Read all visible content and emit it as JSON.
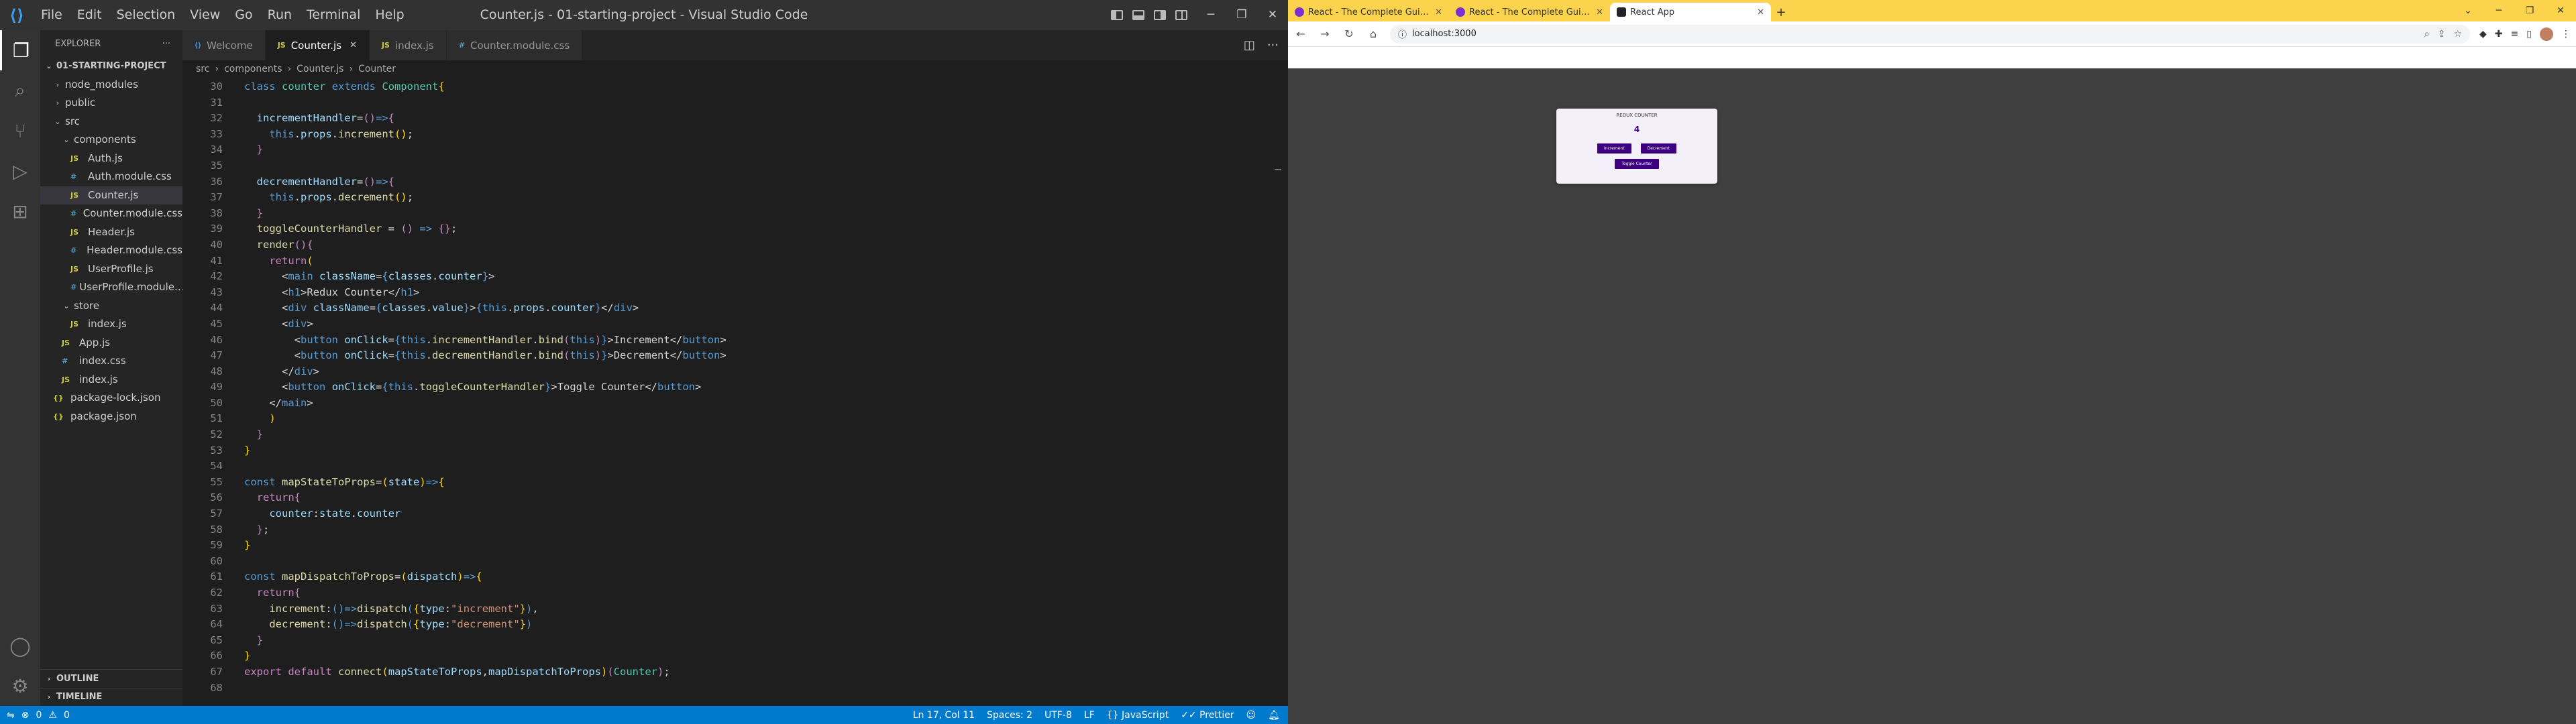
{
  "vscode": {
    "window_title": "Counter.js - 01-starting-project - Visual Studio Code",
    "menu": [
      "File",
      "Edit",
      "Selection",
      "View",
      "Go",
      "Run",
      "Terminal",
      "Help"
    ],
    "explorer_title": "EXPLORER",
    "project": "01-STARTING-PROJECT",
    "tree": [
      {
        "label": "node_modules",
        "type": "folder",
        "depth": 1,
        "open": false
      },
      {
        "label": "public",
        "type": "folder",
        "depth": 1,
        "open": false
      },
      {
        "label": "src",
        "type": "folder",
        "depth": 1,
        "open": true
      },
      {
        "label": "components",
        "type": "folder",
        "depth": 2,
        "open": true
      },
      {
        "label": "Auth.js",
        "type": "js",
        "depth": 3
      },
      {
        "label": "Auth.module.css",
        "type": "css",
        "depth": 3
      },
      {
        "label": "Counter.js",
        "type": "js",
        "depth": 3,
        "selected": true
      },
      {
        "label": "Counter.module.css",
        "type": "css",
        "depth": 3
      },
      {
        "label": "Header.js",
        "type": "js",
        "depth": 3
      },
      {
        "label": "Header.module.css",
        "type": "css",
        "depth": 3
      },
      {
        "label": "UserProfile.js",
        "type": "js",
        "depth": 3
      },
      {
        "label": "UserProfile.module...",
        "type": "css",
        "depth": 3
      },
      {
        "label": "store",
        "type": "folder",
        "depth": 2,
        "open": true
      },
      {
        "label": "index.js",
        "type": "js",
        "depth": 3
      },
      {
        "label": "App.js",
        "type": "js",
        "depth": 2
      },
      {
        "label": "index.css",
        "type": "css",
        "depth": 2
      },
      {
        "label": "index.js",
        "type": "js",
        "depth": 2
      },
      {
        "label": "package-lock.json",
        "type": "json",
        "depth": 1
      },
      {
        "label": "package.json",
        "type": "json",
        "depth": 1
      }
    ],
    "outline": "OUTLINE",
    "timeline": "TIMELINE",
    "tabs": [
      {
        "label": "Welcome",
        "icon": "vscode-icon",
        "active": false
      },
      {
        "label": "Counter.js",
        "icon": "JS",
        "active": true
      },
      {
        "label": "index.js",
        "icon": "JS",
        "active": false
      },
      {
        "label": "Counter.module.css",
        "icon": "#",
        "active": false
      }
    ],
    "breadcrumb": [
      "src",
      "components",
      "Counter.js",
      "Counter"
    ],
    "code_lines": [
      {
        "n": "30",
        "html": "<span class='k'>class</span> <span class='c'>counter</span> <span class='k'>extends</span> <span class='c'>Component</span><span class='y'>{</span>"
      },
      {
        "n": "31",
        "html": ""
      },
      {
        "n": "32",
        "html": "  <span class='v'>incrementHandler</span><span class='p'>=</span><span class='kw'>()</span><span class='k'>=></span><span class='kw'>{</span>"
      },
      {
        "n": "33",
        "html": "    <span class='k'>this</span><span class='p'>.</span><span class='v'>props</span><span class='p'>.</span><span class='f'>increment</span><span class='y'>()</span><span class='p'>;</span>"
      },
      {
        "n": "34",
        "html": "  <span class='kw'>}</span>"
      },
      {
        "n": "35",
        "html": ""
      },
      {
        "n": "36",
        "html": "  <span class='v'>decrementHandler</span><span class='p'>=</span><span class='kw'>()</span><span class='k'>=></span><span class='kw'>{</span>"
      },
      {
        "n": "37",
        "html": "    <span class='k'>this</span><span class='p'>.</span><span class='v'>props</span><span class='p'>.</span><span class='f'>decrement</span><span class='y'>()</span><span class='p'>;</span>"
      },
      {
        "n": "38",
        "html": "  <span class='kw'>}</span>"
      },
      {
        "n": "39",
        "html": "  <span class='f'>toggleCounterHandler</span> <span class='p'>=</span> <span class='kw'>()</span> <span class='k'>=></span> <span class='kw'>{}</span><span class='p'>;</span>"
      },
      {
        "n": "40",
        "html": "  <span class='f'>render</span><span class='kw'>()</span><span class='kw'>{</span>"
      },
      {
        "n": "41",
        "html": "    <span class='kw'>return</span><span class='y'>(</span>"
      },
      {
        "n": "42",
        "html": "      <span class='p'>&lt;</span><span class='t'>main</span> <span class='at'>className</span><span class='p'>=</span><span class='k'>{</span><span class='v'>classes</span><span class='p'>.</span><span class='v'>counter</span><span class='k'>}</span><span class='p'>&gt;</span>"
      },
      {
        "n": "43",
        "html": "      <span class='p'>&lt;</span><span class='t'>h1</span><span class='p'>&gt;</span><span class='p'>Redux Counter</span><span class='p'>&lt;/</span><span class='t'>h1</span><span class='p'>&gt;</span>"
      },
      {
        "n": "44",
        "html": "      <span class='p'>&lt;</span><span class='t'>div</span> <span class='at'>className</span><span class='p'>=</span><span class='k'>{</span><span class='v'>classes</span><span class='p'>.</span><span class='v'>value</span><span class='k'>}</span><span class='p'>&gt;</span><span class='k'>{</span><span class='k'>this</span><span class='p'>.</span><span class='v'>props</span><span class='p'>.</span><span class='v'>counter</span><span class='k'>}</span><span class='p'>&lt;/</span><span class='t'>div</span><span class='p'>&gt;</span>"
      },
      {
        "n": "45",
        "html": "      <span class='p'>&lt;</span><span class='t'>div</span><span class='p'>&gt;</span>"
      },
      {
        "n": "46",
        "html": "        <span class='p'>&lt;</span><span class='t'>button</span> <span class='at'>onClick</span><span class='p'>=</span><span class='k'>{</span><span class='k'>this</span><span class='p'>.</span><span class='f'>incrementHandler</span><span class='p'>.</span><span class='f'>bind</span><span class='kw'>(</span><span class='k'>this</span><span class='kw'>)</span><span class='k'>}</span><span class='p'>&gt;Increment&lt;/</span><span class='t'>button</span><span class='p'>&gt;</span>"
      },
      {
        "n": "47",
        "html": "        <span class='p'>&lt;</span><span class='t'>button</span> <span class='at'>onClick</span><span class='p'>=</span><span class='k'>{</span><span class='k'>this</span><span class='p'>.</span><span class='f'>decrementHandler</span><span class='p'>.</span><span class='f'>bind</span><span class='kw'>(</span><span class='k'>this</span><span class='kw'>)</span><span class='k'>}</span><span class='p'>&gt;Decrement&lt;/</span><span class='t'>button</span><span class='p'>&gt;</span>"
      },
      {
        "n": "48",
        "html": "      <span class='p'>&lt;/</span><span class='t'>div</span><span class='p'>&gt;</span>"
      },
      {
        "n": "49",
        "html": "      <span class='p'>&lt;</span><span class='t'>button</span> <span class='at'>onClick</span><span class='p'>=</span><span class='k'>{</span><span class='k'>this</span><span class='p'>.</span><span class='f'>toggleCounterHandler</span><span class='k'>}</span><span class='p'>&gt;Toggle Counter&lt;/</span><span class='t'>button</span><span class='p'>&gt;</span>"
      },
      {
        "n": "50",
        "html": "    <span class='p'>&lt;/</span><span class='t'>main</span><span class='p'>&gt;</span>"
      },
      {
        "n": "51",
        "html": "    <span class='y'>)</span>"
      },
      {
        "n": "52",
        "html": "  <span class='kw'>}</span>"
      },
      {
        "n": "53",
        "html": "<span class='y'>}</span>"
      },
      {
        "n": "54",
        "html": ""
      },
      {
        "n": "55",
        "html": "<span class='k'>const</span> <span class='f'>mapStateToProps</span><span class='p'>=</span><span class='y'>(</span><span class='v'>state</span><span class='y'>)</span><span class='k'>=></span><span class='y'>{</span>"
      },
      {
        "n": "56",
        "html": "  <span class='kw'>return</span><span class='kw'>{</span>"
      },
      {
        "n": "57",
        "html": "    <span class='v'>counter</span><span class='p'>:</span><span class='v'>state</span><span class='p'>.</span><span class='v'>counter</span>"
      },
      {
        "n": "58",
        "html": "  <span class='kw'>}</span><span class='p'>;</span>"
      },
      {
        "n": "59",
        "html": "<span class='y'>}</span>"
      },
      {
        "n": "60",
        "html": ""
      },
      {
        "n": "61",
        "html": "<span class='k'>const</span> <span class='f'>mapDispatchToProps</span><span class='p'>=</span><span class='y'>(</span><span class='v'>dispatch</span><span class='y'>)</span><span class='k'>=></span><span class='y'>{</span>"
      },
      {
        "n": "62",
        "html": "  <span class='kw'>return</span><span class='kw'>{</span>"
      },
      {
        "n": "63",
        "html": "    <span class='f'>increment</span><span class='p'>:</span><span class='k'>()</span><span class='k'>=></span><span class='f'>dispatch</span><span class='k'>(</span><span class='y'>{</span><span class='v'>type</span><span class='p'>:</span><span class='s'>\"increment\"</span><span class='y'>}</span><span class='k'>)</span><span class='p'>,</span>"
      },
      {
        "n": "64",
        "html": "    <span class='f'>decrement</span><span class='p'>:</span><span class='k'>()</span><span class='k'>=></span><span class='f'>dispatch</span><span class='k'>(</span><span class='y'>{</span><span class='v'>type</span><span class='p'>:</span><span class='s'>\"decrement\"</span><span class='y'>}</span><span class='k'>)</span>"
      },
      {
        "n": "65",
        "html": "  <span class='kw'>}</span>"
      },
      {
        "n": "66",
        "html": "<span class='y'>}</span>"
      },
      {
        "n": "67",
        "html": "<span class='kw'>export</span> <span class='kw'>default</span> <span class='f'>connect</span><span class='y'>(</span><span class='v'>mapStateToProps</span><span class='p'>,</span><span class='v'>mapDispatchToProps</span><span class='y'>)</span><span class='kw'>(</span><span class='c'>Counter</span><span class='kw'>)</span><span class='p'>;</span>"
      },
      {
        "n": "68",
        "html": ""
      }
    ],
    "status": {
      "errors": "0",
      "warnings": "0",
      "position": "Ln 17, Col 11",
      "spaces": "Spaces: 2",
      "encoding": "UTF-8",
      "eol": "LF",
      "language": "JavaScript",
      "formatter": "Prettier"
    },
    "colors": {
      "statusbar": "#007acc",
      "activity": "#333333",
      "sidebar": "#252526",
      "editor": "#1e1e1e"
    }
  },
  "chrome": {
    "tabs": [
      {
        "label": "React - The Complete Guide (incl",
        "active": false
      },
      {
        "label": "React - The Complete Guide (incl",
        "active": false
      },
      {
        "label": "React App",
        "active": true
      }
    ],
    "url": "localhost:3000",
    "app": {
      "title": "REDUX COUNTER",
      "value": "4",
      "increment": "Increment",
      "decrement": "Decrement",
      "toggle": "Toggle Counter"
    },
    "colors": {
      "tabstrip": "#fcd34d",
      "button": "#3c0080",
      "card": "#f4f0fa"
    }
  }
}
